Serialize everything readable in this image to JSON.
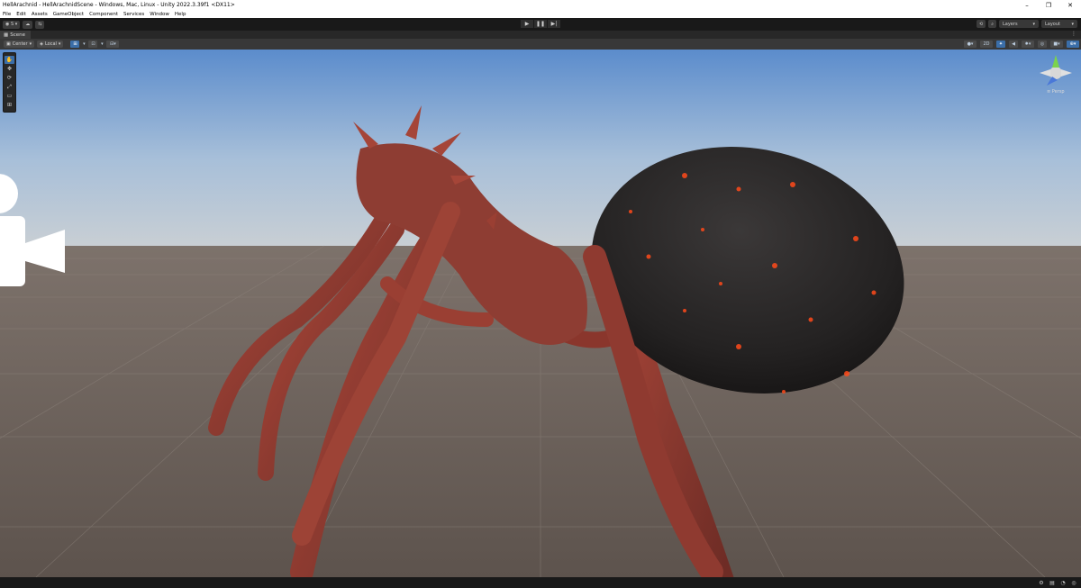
{
  "window": {
    "title": "HellArachnid - HellArachnidScene - Windows, Mac, Linux - Unity 2022.3.39f1 <DX11>",
    "minimize": "–",
    "maximize": "❐",
    "close": "✕"
  },
  "menu": [
    "File",
    "Edit",
    "Assets",
    "GameObject",
    "Component",
    "Services",
    "Window",
    "Help"
  ],
  "toolbar": {
    "account_label": "S",
    "layers_label": "Layers",
    "layout_label": "Layout"
  },
  "tab": {
    "label": "Scene",
    "menu": "⋮"
  },
  "scene_toolbar": {
    "pivot_label": "Center",
    "space_label": "Local",
    "mode_2d": "2D"
  },
  "gizmo": {
    "label": "≡ Persp"
  },
  "colors": {
    "accent": "#3b6ea8",
    "sky_top": "#5f8fcd",
    "ground": "#6a5f58"
  }
}
